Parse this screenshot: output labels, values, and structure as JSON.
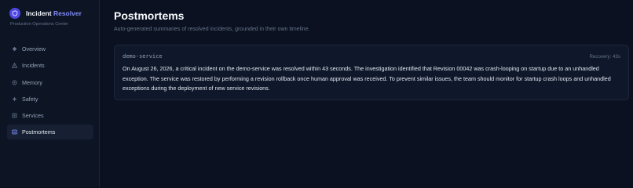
{
  "sidebar": {
    "brand_name": "Incident",
    "brand_accent": "Resolver",
    "subtitle": "Production Operations Center",
    "items": [
      {
        "label": "Overview",
        "icon": "diamond-icon"
      },
      {
        "label": "Incidents",
        "icon": "warning-icon"
      },
      {
        "label": "Memory",
        "icon": "memory-icon"
      },
      {
        "label": "Safety",
        "icon": "safety-icon"
      },
      {
        "label": "Services",
        "icon": "services-icon"
      },
      {
        "label": "Postmortems",
        "icon": "document-icon",
        "active": true
      }
    ]
  },
  "main": {
    "title": "Postmortems",
    "subtitle": "Auto-generated summaries of resolved incidents, grounded in their own timeline.",
    "postmortems": [
      {
        "service": "demo-service",
        "recovery": "Recovery: 43s",
        "summary": "On August 26, 2026, a critical incident on the demo-service was resolved within 43 seconds. The investigation identified that Revision 00042 was crash-looping on startup due to an unhandled exception. The service was restored by performing a revision rollback once human approval was received. To prevent similar issues, the team should monitor for startup crash loops and unhandled exceptions during the deployment of new service revisions."
      }
    ]
  },
  "colors": {
    "background": "#0b1120",
    "sidebar": "#0d1424",
    "accent": "#818cf8",
    "logo": "#4f46e5",
    "card": "#0f172a",
    "active_item": "#172033"
  }
}
